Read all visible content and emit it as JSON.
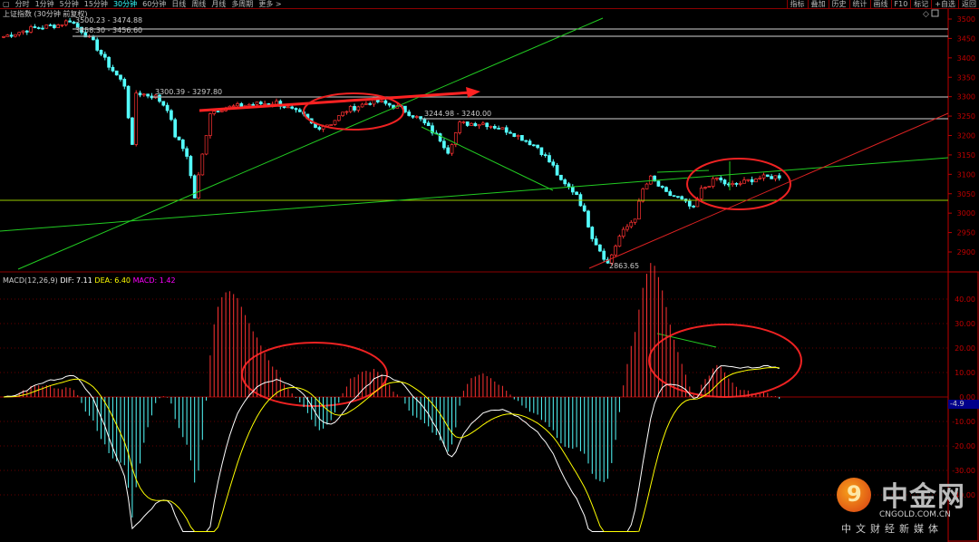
{
  "toolbar": {
    "periods": [
      "分时",
      "1分钟",
      "5分钟",
      "15分钟",
      "30分钟",
      "60分钟",
      "日线",
      "周线",
      "月线",
      "多周期",
      "更多 >"
    ],
    "active": "30分钟",
    "right": [
      "指标",
      "叠加",
      "历史",
      "统计",
      "画线",
      "F10",
      "标记",
      "+自选",
      "返回"
    ]
  },
  "title": "上证指数 (30分钟 前复权)",
  "macd": {
    "name": "MACD(12,26,9)",
    "dif": "DIF: 7.11",
    "dea": "DEA: 6.40",
    "macd": "MACD: 1.42",
    "current_label": "-4.9"
  },
  "annotations": {
    "a1": "3500.23 - 3474.88",
    "a2": "3458.30 - 3456.60",
    "a3": "3300.39 - 3297.80",
    "a4": "3244.98 - 3240.00",
    "low": "2863.65"
  },
  "colors": {
    "up": "#ff3232",
    "down": "#54ffff",
    "dif": "#ffffff",
    "dea": "#ffff00",
    "axis": "#c00000"
  },
  "watermark": {
    "name": "中金网",
    "domain": "CNGOLD.COM.CN",
    "slogan": "中文财经新媒体"
  },
  "chart_data": {
    "type": "candlestick",
    "price_axis": [
      "3500",
      "3450",
      "3400",
      "3350",
      "3300",
      "3250",
      "3200",
      "3150",
      "3100",
      "3050",
      "3000",
      "2950",
      "2900"
    ],
    "macd_axis": [
      "40.00",
      "30.00",
      "20.00",
      "10.00",
      "0.00",
      "-10.00",
      "-20.00",
      "-30.00",
      "-40.00"
    ],
    "price_range": [
      2870,
      3520
    ],
    "candle_count": 200,
    "waypoints": [
      [
        0,
        3455
      ],
      [
        7,
        3475
      ],
      [
        14,
        3485
      ],
      [
        17,
        3497
      ],
      [
        20,
        3470
      ],
      [
        23,
        3440
      ],
      [
        27,
        3380
      ],
      [
        31,
        3330
      ],
      [
        33,
        3170
      ],
      [
        34,
        3310
      ],
      [
        39,
        3300
      ],
      [
        42,
        3270
      ],
      [
        44,
        3200
      ],
      [
        47,
        3150
      ],
      [
        49,
        3040
      ],
      [
        51,
        3150
      ],
      [
        53,
        3260
      ],
      [
        56,
        3270
      ],
      [
        63,
        3280
      ],
      [
        70,
        3285
      ],
      [
        77,
        3250
      ],
      [
        80,
        3220
      ],
      [
        84,
        3232
      ],
      [
        88,
        3265
      ],
      [
        95,
        3290
      ],
      [
        102,
        3270
      ],
      [
        107,
        3240
      ],
      [
        112,
        3190
      ],
      [
        114,
        3160
      ],
      [
        117,
        3230
      ],
      [
        123,
        3232
      ],
      [
        130,
        3210
      ],
      [
        137,
        3170
      ],
      [
        141,
        3120
      ],
      [
        143,
        3080
      ],
      [
        147,
        3050
      ],
      [
        149,
        3000
      ],
      [
        151,
        2940
      ],
      [
        155,
        2870
      ],
      [
        158,
        2940
      ],
      [
        162,
        2990
      ],
      [
        164,
        3060
      ],
      [
        166,
        3090
      ],
      [
        170,
        3050
      ],
      [
        173,
        3040
      ],
      [
        177,
        3010
      ],
      [
        179,
        3060
      ],
      [
        183,
        3090
      ],
      [
        186,
        3070
      ],
      [
        190,
        3080
      ],
      [
        193,
        3090
      ],
      [
        199,
        3095
      ]
    ]
  }
}
